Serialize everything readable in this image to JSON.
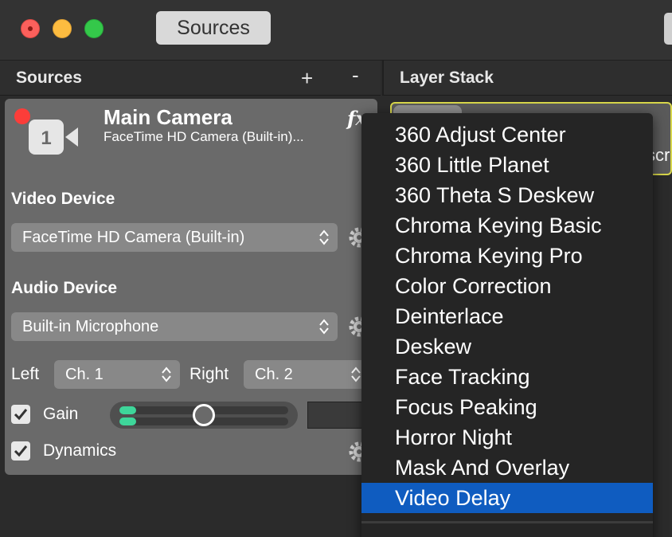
{
  "window": {
    "title": "Sources"
  },
  "sources_panel": {
    "header": "Sources",
    "add_label": "+",
    "remove_label": "-"
  },
  "layer_panel": {
    "header": "Layer Stack",
    "item_partial_text": "scr"
  },
  "source_card": {
    "number_badge": "1",
    "title": "Main Camera",
    "subtitle": "FaceTime HD Camera (Built-in)...",
    "fx_label": "fx",
    "video_device_label": "Video Device",
    "video_device_value": "FaceTime HD Camera (Built-in)",
    "audio_device_label": "Audio Device",
    "audio_device_value": "Built-in Microphone",
    "left_label": "Left",
    "left_value": "Ch. 1",
    "right_label": "Right",
    "right_value": "Ch. 2",
    "gain_label": "Gain",
    "gain_checked": true,
    "gain_value": "1",
    "dynamics_label": "Dynamics",
    "dynamics_checked": true,
    "meter_level_top": 0.1,
    "meter_level_bottom": 0.1,
    "slider_position": 0.5
  },
  "fx_menu": {
    "items": [
      "360 Adjust Center",
      "360 Little Planet",
      "360 Theta S Deskew",
      "Chroma Keying Basic",
      "Chroma Keying Pro",
      "Color Correction",
      "Deinterlace",
      "Deskew",
      "Face Tracking",
      "Focus Peaking",
      "Horror Night",
      "Mask And Overlay",
      "Video Delay"
    ],
    "selected_index": 12
  },
  "colors": {
    "selection": "#0f5cc0",
    "meter": "#3ed69a",
    "record": "#fc3d39",
    "layer_highlight": "#d7d64a"
  }
}
